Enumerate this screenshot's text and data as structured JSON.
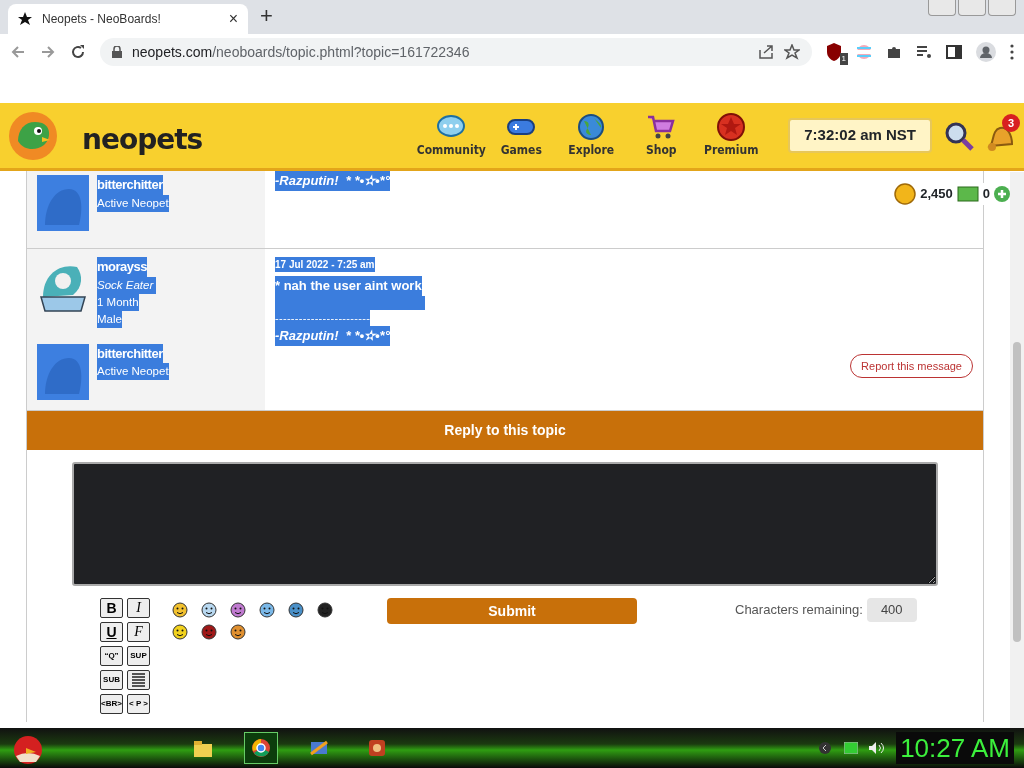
{
  "browser": {
    "tab": {
      "title": "Neopets - NeoBoards!",
      "close": "×"
    },
    "new_tab": "+",
    "url_host": "neopets.com",
    "url_path": "/neoboards/topic.phtml?topic=161722346",
    "extension_badge": "1"
  },
  "site_header": {
    "logo": "neopets",
    "nav": [
      {
        "label": "Community"
      },
      {
        "label": "Games"
      },
      {
        "label": "Explore"
      },
      {
        "label": "Shop"
      },
      {
        "label": "Premium"
      }
    ],
    "clock": "7:32:02 am NST",
    "notification_count": "3"
  },
  "currency": {
    "np": "2,450",
    "nc": "0"
  },
  "posts": [
    {
      "highlighted": true,
      "pet": {
        "name": "bitterchitter",
        "status": "Active Neopet"
      },
      "signature": "-Razputin!  * *•✫•*°"
    },
    {
      "highlighted": true,
      "author": {
        "name": "morayss",
        "title": "Sock Eater",
        "age": "1 Month",
        "gender": "Male"
      },
      "pet": {
        "name": "bitterchitter",
        "status": "Active Neopet"
      },
      "date": "17 Jul 2022 - 7:25 am",
      "message": "* nah the user aint work",
      "divider": "------------------------",
      "signature": "-Razputin!  * *•✫•*°",
      "report_button": "Report this message"
    }
  ],
  "reply": {
    "title": "Reply to this topic",
    "tools": [
      {
        "kind": "text",
        "label": "B"
      },
      {
        "kind": "text",
        "label": "I"
      },
      {
        "kind": "text",
        "label": "U"
      },
      {
        "kind": "text",
        "label": "F"
      },
      {
        "kind": "text",
        "label": "“Q”"
      },
      {
        "kind": "text",
        "label": "SUP"
      },
      {
        "kind": "text",
        "label": "SUB"
      },
      {
        "kind": "icon"
      },
      {
        "kind": "text",
        "label": "<BR>"
      },
      {
        "kind": "text",
        "label": "< P >"
      }
    ],
    "smileys": [
      {
        "color": "#f2c12e"
      },
      {
        "color": "#b8d8f0"
      },
      {
        "color": "#c07ad0"
      },
      {
        "color": "#7ab8e8"
      },
      {
        "color": "#4a90c8"
      },
      {
        "color": "#222222"
      },
      {
        "color": "#f2d21e"
      },
      {
        "color": "#a01818"
      },
      {
        "color": "#e09030"
      }
    ],
    "submit": "Submit",
    "chars_label": "Characters remaining:",
    "chars_remaining": "400"
  },
  "taskbar": {
    "apps": [
      {
        "selected": false
      },
      {
        "selected": true
      },
      {
        "selected": false
      },
      {
        "selected": false
      }
    ],
    "clock": "10:27 AM"
  }
}
